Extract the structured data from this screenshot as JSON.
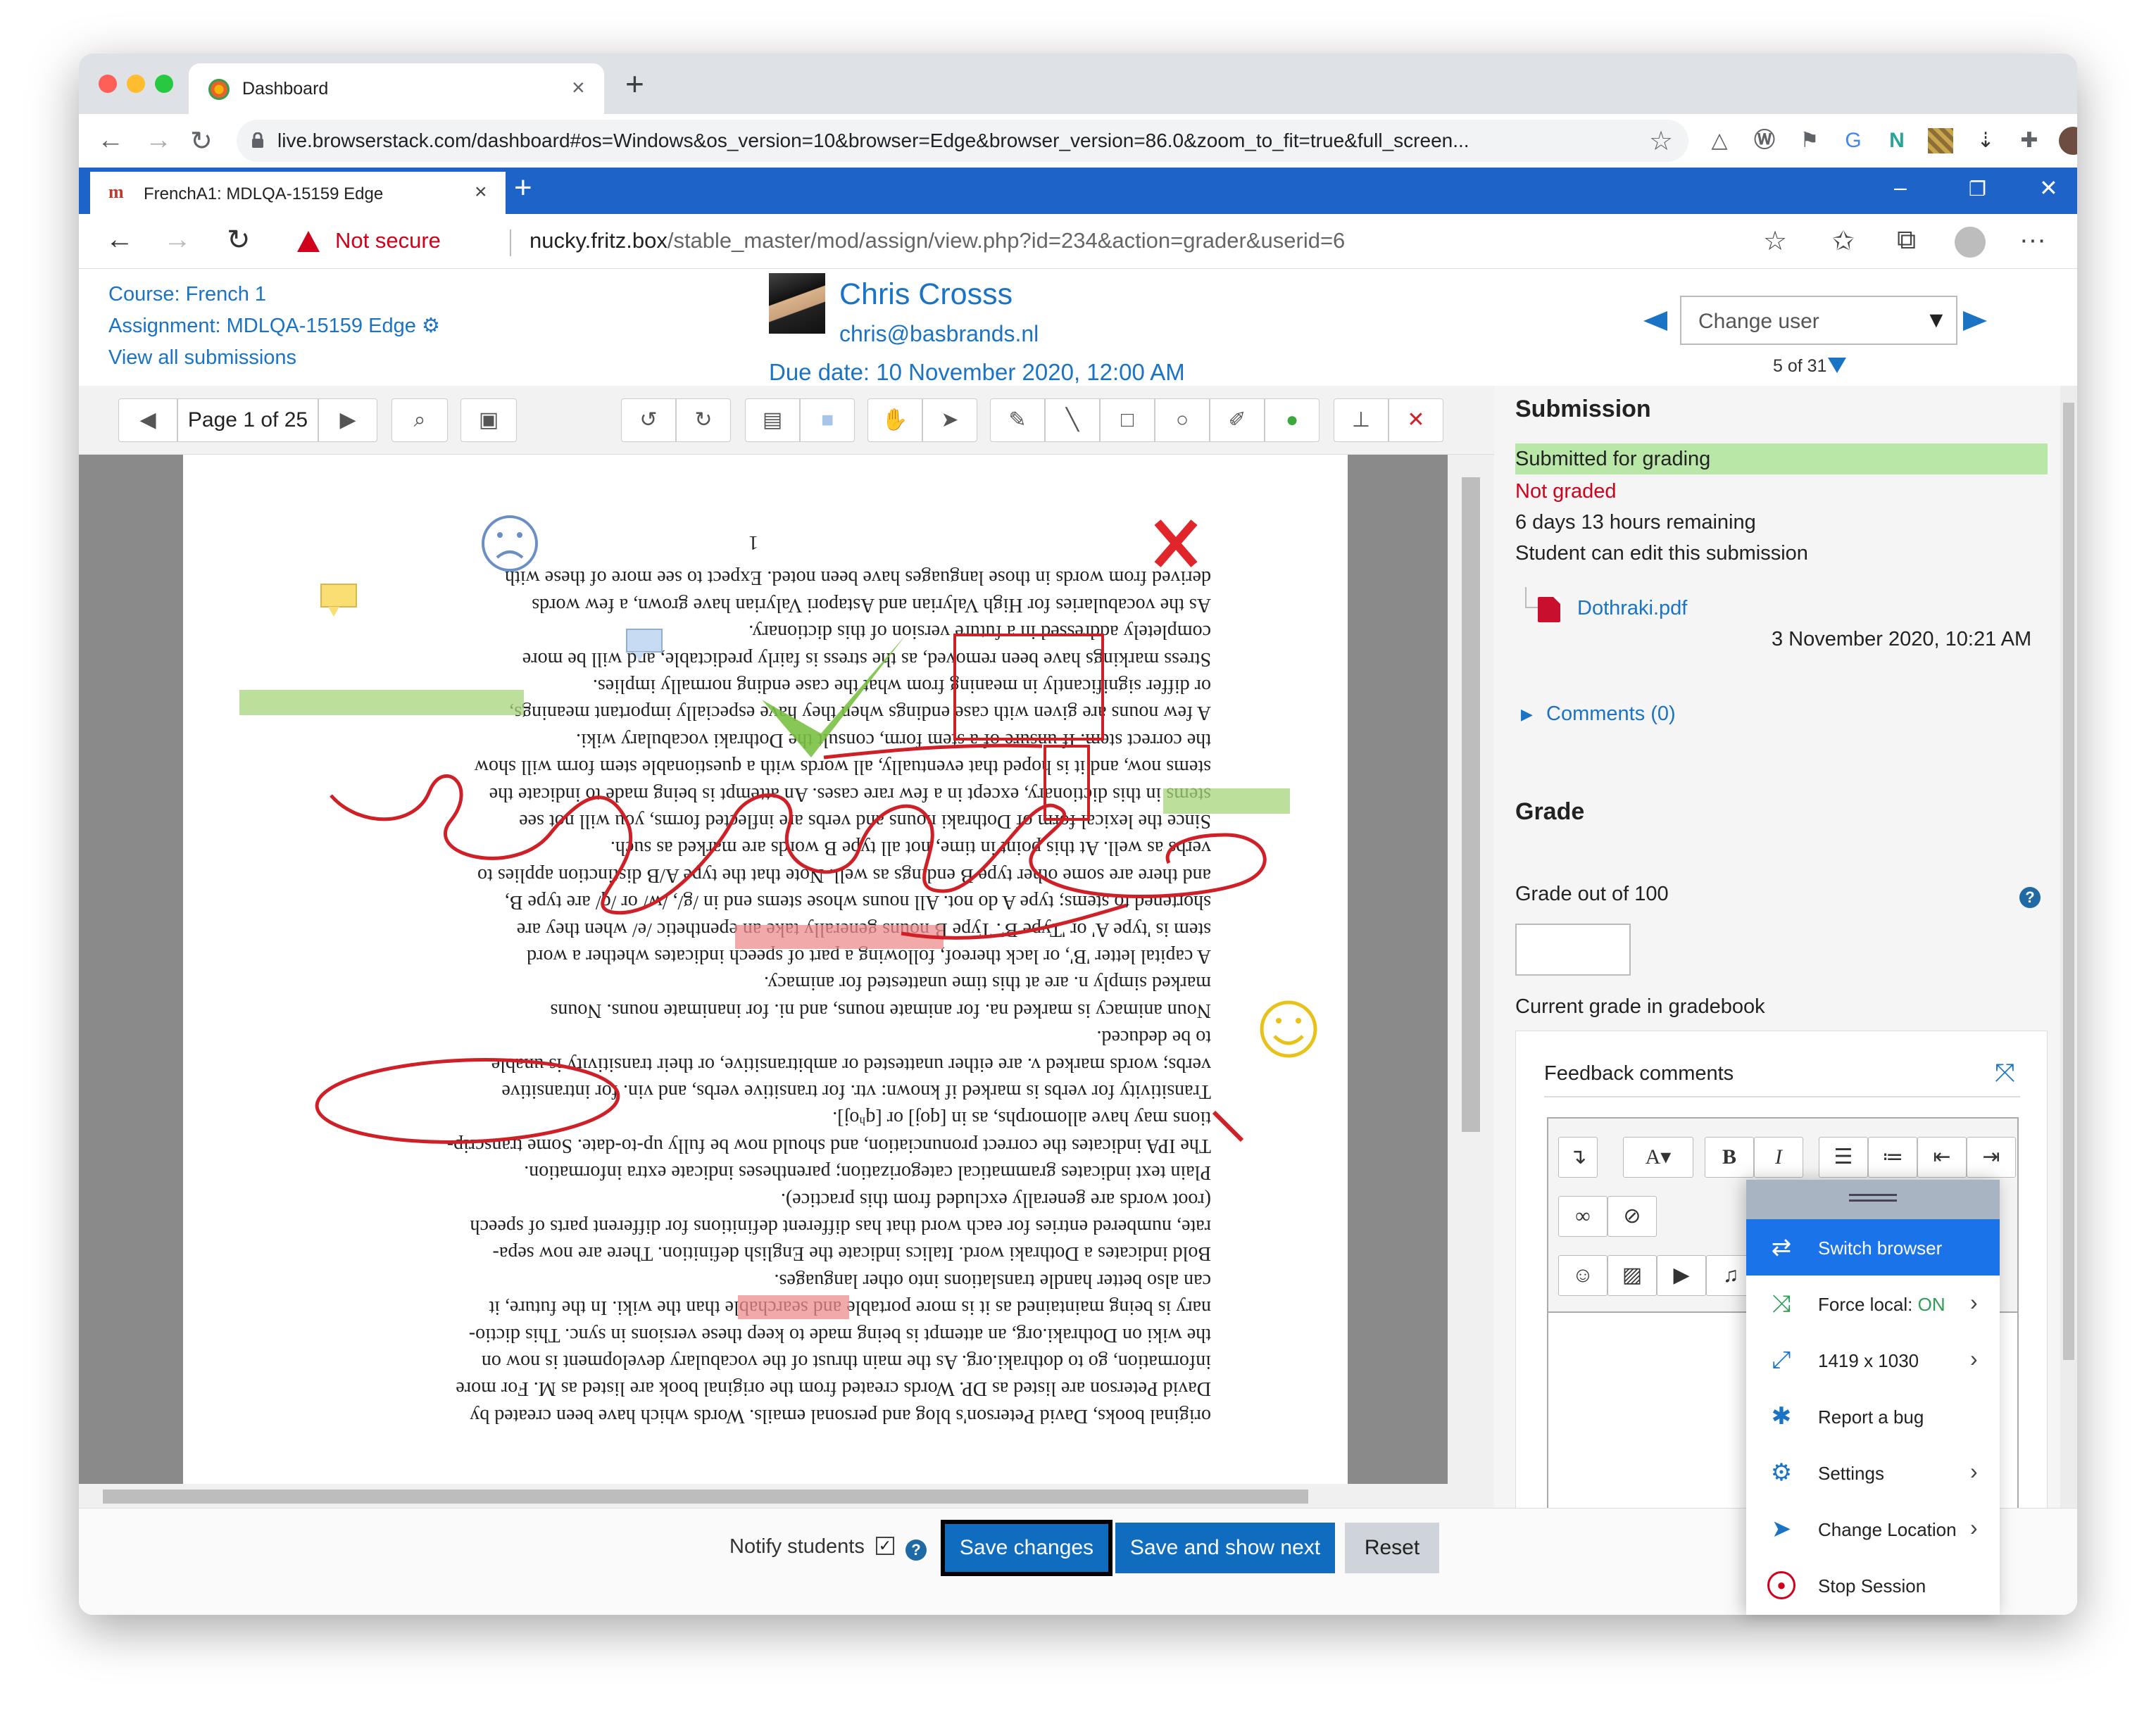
{
  "chrome": {
    "tab_title": "Dashboard",
    "tab_close": "×",
    "new_tab": "+",
    "back": "←",
    "forward": "→",
    "reload": "↻",
    "url": "live.browserstack.com/dashboard#os=Windows&os_version=10&browser=Edge&browser_version=86.0&zoom_to_fit=true&full_screen...",
    "bookmark_star": "☆",
    "menu": "⋮"
  },
  "edge": {
    "tab_favicon": "m",
    "tab_title": "FrenchA1: MDLQA-15159 Edge",
    "tab_close": "×",
    "new_tab": "+",
    "win_minimize": "–",
    "win_restore": "❐",
    "win_close": "✕",
    "back": "←",
    "forward": "→",
    "reload": "↻",
    "not_secure": "Not secure",
    "url_host": "nucky.fritz.box",
    "url_path": "/stable_master/mod/assign/view.php?id=234&action=grader&userid=6",
    "favorite": "☆",
    "favorites": "✩",
    "collections": "⧉",
    "more": "···"
  },
  "header": {
    "course": "Course: French 1",
    "assignment": "Assignment: MDLQA-15159 Edge",
    "gear": "⚙",
    "view_all": "View all submissions",
    "student_name": "Chris Crosss",
    "student_email": "chris@basbrands.nl",
    "due_date": "Due date: 10 November 2020, 12:00 AM",
    "change_user": "Change user",
    "dropdown_arrow": "▼",
    "user_count": "5 of 31"
  },
  "pdf_toolbar": {
    "page_label": "Page 1 of 25",
    "prev": "◀",
    "next": "▶"
  },
  "document": {
    "page_number": "1",
    "lines": [
      "derived from words in those languages have been noted. Expect to see more of these with",
      "As the vocabularies for High Valyrian and Astapori Valyrian have grown, a few words",
      "completely addressed in a future version of this dictionary.",
      "Stress markings have been removed, as the stress is fairly predictable, and will be more",
      "or differ significantly in meaning from what the case ending normally implies.",
      "A few nouns are given with case endings when they have especially important meanings,",
      "the correct stem. If unsure of a stem form, consult the Dothraki vocabulary wiki.",
      "stems now, and it is hoped that eventually, all words with a questionable stem form will show",
      "stems in this dictionary, except in a few rare cases. An attempt is being made to indicate the",
      "Since the lexical form of Dothraki nouns and verbs are inflected forms, you will not see",
      "verbs as well. At this point in time, not all type B words are marked as such.",
      "and there are some other type B endings as well. Note that the type A/B distinction applies to",
      "shortened to stems; type A do not. All nouns whose stems end in /g/, /w/ or /q/ are type B,",
      "stem is 'type A' or 'Type B'. Type B nouns generally take an epenthetic /e/ when they are",
      "A capital letter 'B', or lack thereof, following a part of speech indicates whether a word",
      "marked simply n. are at this time unattested for animacy.",
      "Noun animacy is marked na. for animate nouns, and ni. for inanimate nouns. Nouns",
      "to be deduced.",
      "verbs; words marked v. are either unattested or ambitransitive, or their transitivity is unable",
      "Transitivity for verbs is marked if known: vtr. for transitive verbs, and vin. for intransitive",
      "tions may have allomorphs, as in [qoj] or [qʰoj].",
      "The IPA indicates the correct pronunciation, and should now be fully up-to-date. Some transcrip-",
      "Plain text indicates grammatical categorization; parentheses indicate extra information.",
      "(root words are generally excluded from this practice).",
      "rate, numbered entries for each word that has different definitions for different parts of speech",
      "Bold indicates a Dothraki word. Italics indicate the English definition. There are now sepa-",
      "can also better handle translations into other languages.",
      "nary is being maintained as it is more portable and searchable than the wiki. In the future, it",
      "the wiki on Dothraki.org, an attempt is being made to keep these versions in sync. This dictio-",
      "information, go to dothraki.org. As the main thrust of the vocabulary development is now on",
      "David Peterson are listed as DP. Words created from the original book are listed as M. For more",
      "original books, David Peterson's blog and personal emails. Words which have been created by"
    ]
  },
  "submission": {
    "heading": "Submission",
    "status": "Submitted for grading",
    "grading_status": "Not graded",
    "time_remaining": "6 days 13 hours remaining",
    "editable": "Student can edit this submission",
    "file_name": "Dothraki.pdf",
    "file_date": "3 November 2020, 10:21 AM",
    "comments": "Comments (0)"
  },
  "grade": {
    "heading": "Grade",
    "grade_out_of": "Grade out of 100",
    "help": "?",
    "current_grade": "Current grade in gradebook",
    "current_value": "-",
    "feedback_title": "Feedback comments"
  },
  "editor": {
    "bold": "B",
    "italic": "I",
    "font": "A▾"
  },
  "actions": {
    "notify_label": "Notify students",
    "notify_checked": "✓",
    "save": "Save changes",
    "save_next": "Save and show next",
    "reset": "Reset"
  },
  "bs_menu": {
    "items": [
      {
        "label": "Switch browser",
        "icon": "⇄"
      },
      {
        "label": "Force local: ",
        "value": "ON",
        "icon": "⤨"
      },
      {
        "label": "1419 x 1030",
        "icon": "⤢"
      },
      {
        "label": "Report a bug",
        "icon": "✱"
      },
      {
        "label": "Settings",
        "icon": "⚙"
      },
      {
        "label": "Change Location",
        "icon": "➤"
      },
      {
        "label": "Stop Session",
        "icon": "●"
      }
    ],
    "chevron": "›"
  },
  "colors": {
    "moodle_blue": "#0f6cbf",
    "link_blue": "#1a73c4",
    "edge_blue": "#1e63c8",
    "not_graded_red": "#d0021b",
    "submitted_green": "#b9e7a8",
    "annotation_red": "#d02027",
    "annotation_green": "#7ac143"
  }
}
